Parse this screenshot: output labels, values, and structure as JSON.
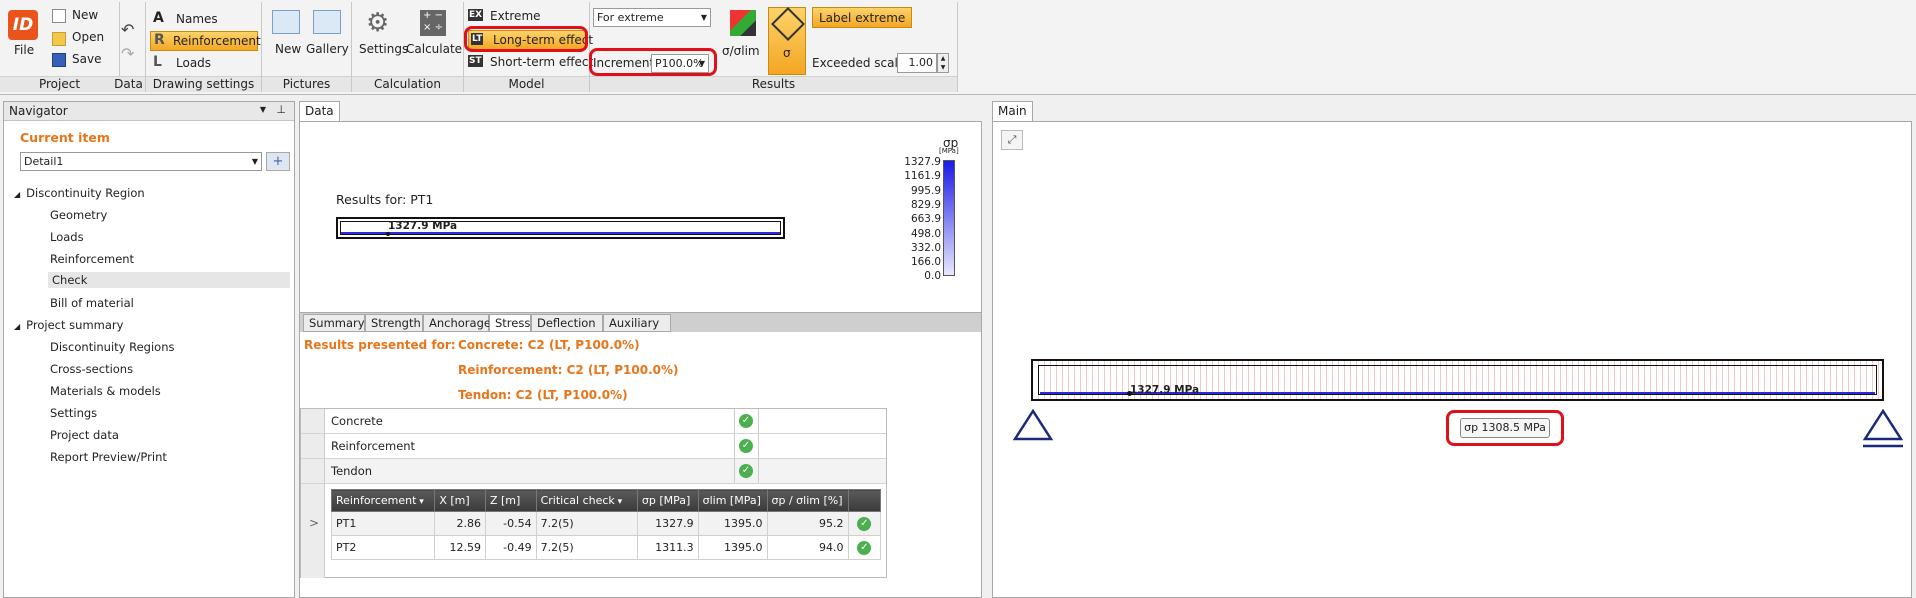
{
  "ribbon": {
    "file_label": "File",
    "logo_text": "ID",
    "project": {
      "new": "New",
      "open": "Open",
      "save": "Save",
      "group": "Project"
    },
    "data_group": "Data",
    "drawing": {
      "names": "Names",
      "reinforcement": "Reinforcement",
      "loads": "Loads",
      "group": "Drawing settings"
    },
    "pictures": {
      "new": "New",
      "gallery": "Gallery",
      "group": "Pictures"
    },
    "calculation": {
      "settings": "Settings",
      "calculate": "Calculate",
      "group": "Calculation"
    },
    "model": {
      "extreme": "Extreme",
      "long_term": "Long-term effect",
      "short_term": "Short-term effect",
      "group": "Model",
      "ex_badge": "EX",
      "lt_badge": "LT",
      "st_badge": "ST"
    },
    "results": {
      "for_extreme": "For extreme",
      "increment_label": "Increment",
      "increment_value": "P100.0%",
      "sigma_olim": "σ/σlim",
      "sigma": "σ",
      "label_extreme": "Label extreme",
      "exceeded_scale_label": "Exceeded scale",
      "exceeded_scale_value": "1.00",
      "group": "Results"
    }
  },
  "navigator": {
    "title": "Navigator",
    "current_item_label": "Current item",
    "current_item_value": "Detail1",
    "tree": [
      {
        "label": "Discontinuity Region",
        "level": 0
      },
      {
        "label": "Geometry",
        "level": 1
      },
      {
        "label": "Loads",
        "level": 1
      },
      {
        "label": "Reinforcement",
        "level": 1
      },
      {
        "label": "Check",
        "level": 1,
        "selected": true
      },
      {
        "label": "Bill of material",
        "level": 1
      },
      {
        "label": "Project summary",
        "level": 0
      },
      {
        "label": "Discontinuity Regions",
        "level": 1
      },
      {
        "label": "Cross-sections",
        "level": 1
      },
      {
        "label": "Materials & models",
        "level": 1
      },
      {
        "label": "Settings",
        "level": 1
      },
      {
        "label": "Project data",
        "level": 1
      },
      {
        "label": "Report Preview/Print",
        "level": 1
      }
    ]
  },
  "data_panel": {
    "tab": "Data",
    "results_for": "Results for: PT1",
    "beam_label": "1327.9 MPa",
    "legend_title": "σp",
    "legend_unit": "[MPa]",
    "legend_values": [
      "1327.9",
      "1161.9",
      "995.9",
      "829.9",
      "663.9",
      "498.0",
      "332.0",
      "166.0",
      "0.0"
    ],
    "subtabs": [
      "Summary",
      "Strength",
      "Anchorage",
      "Stress",
      "Deflection",
      "Auxiliary"
    ],
    "active_subtab": "Stress",
    "results_presented_for": "Results presented for:",
    "concrete_line": "Concrete: C2 (LT, P100.0%)",
    "reinforcement_line": "Reinforcement: C2 (LT, P100.0%)",
    "tendon_line": "Tendon: C2 (LT, P100.0%)",
    "checks": [
      "Concrete",
      "Reinforcement",
      "Tendon"
    ],
    "expand_mark": ">",
    "table": {
      "headers": [
        "Reinforcement",
        "X [m]",
        "Z [m]",
        "Critical check",
        "σp [MPa]",
        "σlim [MPa]",
        "σp / σlim [%]"
      ],
      "rows": [
        [
          "PT1",
          "2.86",
          "-0.54",
          "7.2(5)",
          "1327.9",
          "1395.0",
          "95.2"
        ],
        [
          "PT2",
          "12.59",
          "-0.49",
          "7.2(5)",
          "1311.3",
          "1395.0",
          "94.0"
        ]
      ]
    }
  },
  "main_panel": {
    "tab": "Main",
    "beam_label": "1327.9 MPa",
    "tooltip": "σp 1308.5 MPa"
  },
  "colors": {
    "accent_orange": "#e8751a",
    "highlight": "#f5a623",
    "red_callout": "#e0101a",
    "legend_blue": "#2a2adf"
  }
}
